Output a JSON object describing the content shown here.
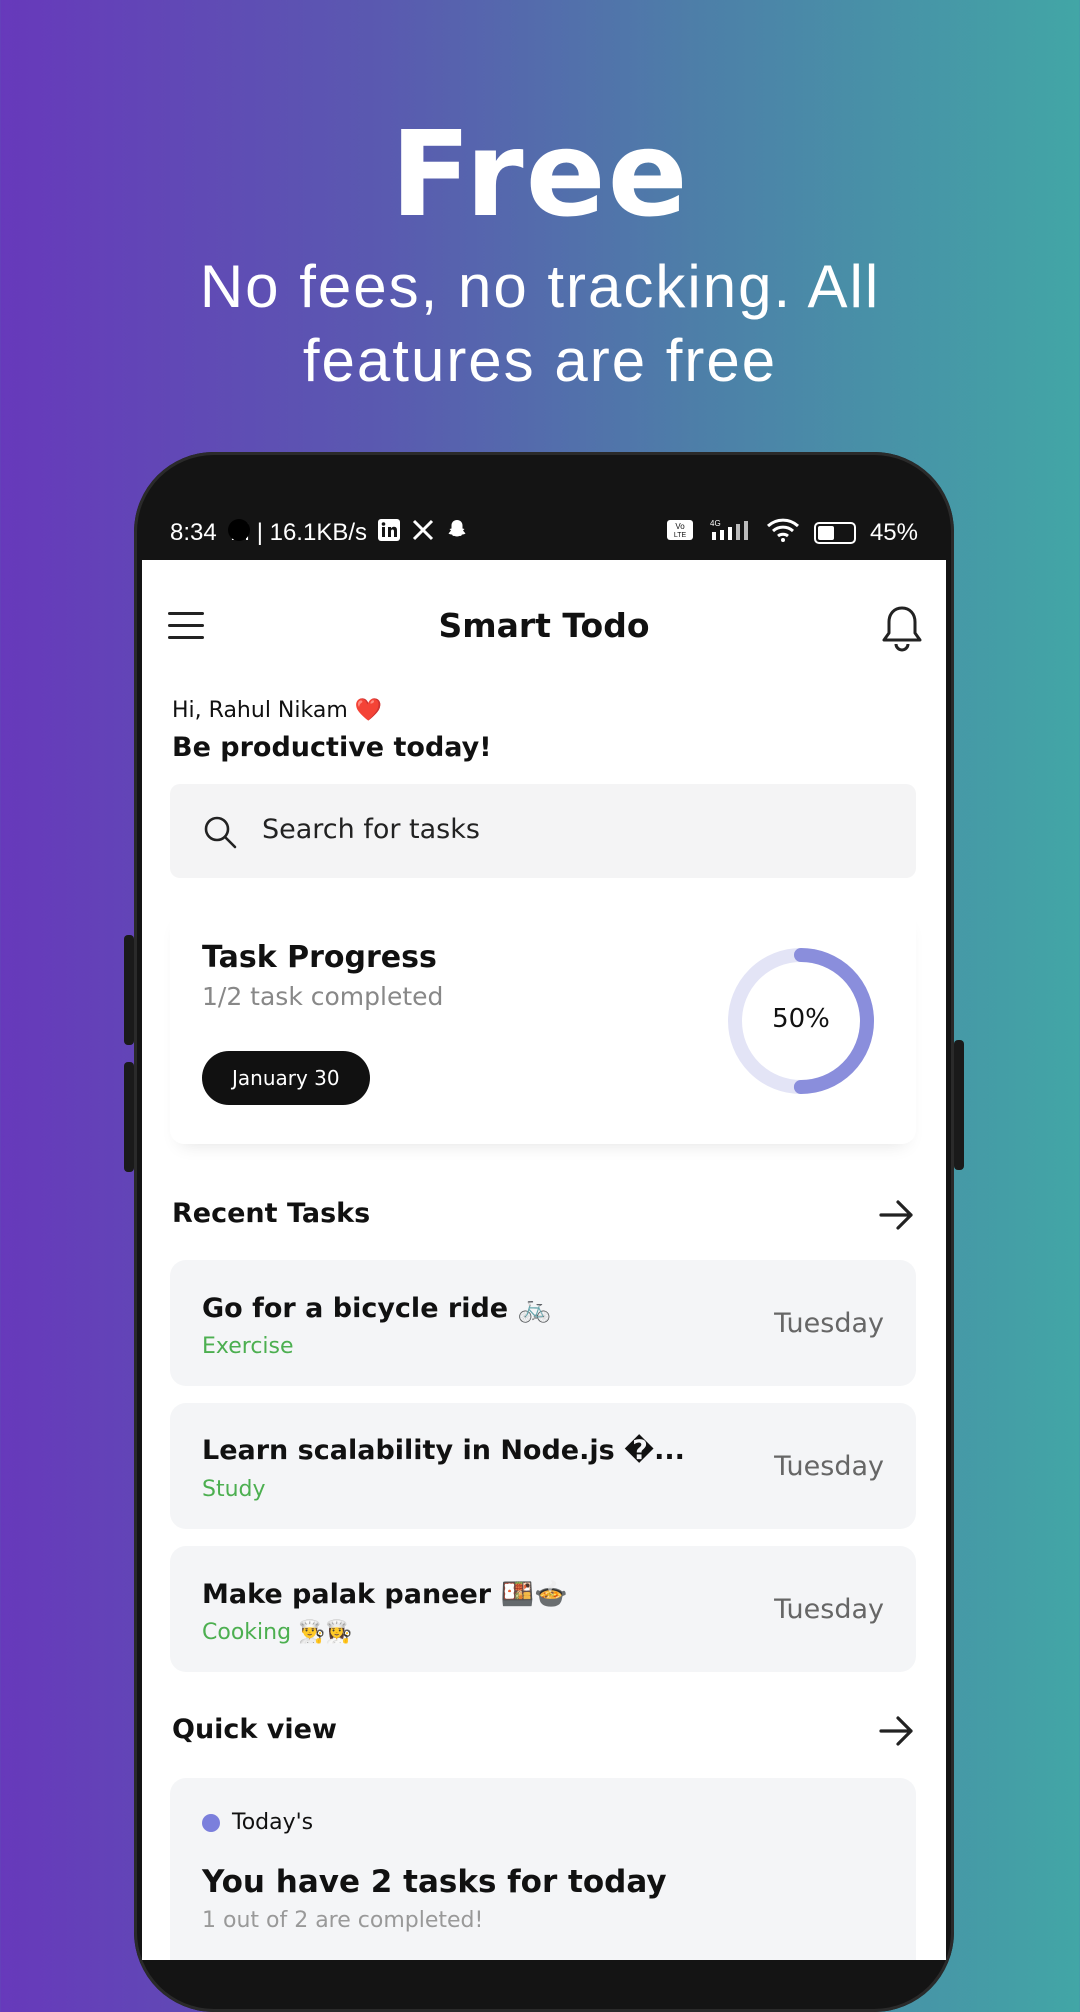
{
  "promo": {
    "title": "Free",
    "subtitle": "No fees, no tracking. All features are free"
  },
  "status_bar": {
    "time_speed": "8:34  M | 16.1KB/s",
    "icons": [
      "linkedin-icon",
      "x-icon",
      "snapchat-icon"
    ],
    "right_icons": [
      "volte-icon",
      "signal-icon",
      "wifi-icon",
      "battery-icon"
    ],
    "battery": "45%"
  },
  "header": {
    "title": "Smart Todo"
  },
  "greeting": {
    "hello": "Hi, Rahul Nikam ❤️",
    "tagline": "Be productive today!"
  },
  "search": {
    "placeholder": "Search for tasks"
  },
  "progress": {
    "title": "Task Progress",
    "subtitle": "1/2 task completed",
    "date": "January 30",
    "percent_label": "50%",
    "percent": 0.5,
    "ring_color": "#8a8edc",
    "ring_track": "#e3e4f6"
  },
  "recent": {
    "heading": "Recent Tasks",
    "tasks": [
      {
        "title": "Go for a bicycle ride 🚲",
        "category": "Exercise",
        "day": "Tuesday"
      },
      {
        "title": "Learn scalability in Node.js �...",
        "category": "Study",
        "day": "Tuesday"
      },
      {
        "title": "Make palak paneer 🍱🍲",
        "category": "Cooking 👨‍🍳👩‍🍳",
        "day": "Tuesday"
      }
    ]
  },
  "quick_view": {
    "heading": "Quick view",
    "label": "Today's",
    "title": "You have 2 tasks for today",
    "subtitle": "1 out of 2 are completed!"
  },
  "colors": {
    "accent": "#7b7fdc",
    "category": "#4caf50"
  }
}
